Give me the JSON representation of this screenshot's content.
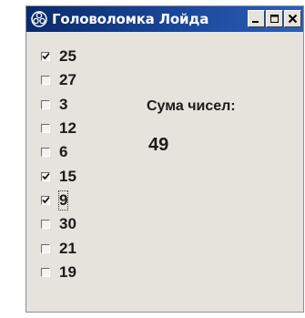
{
  "window": {
    "title": "Головоломка Лойда",
    "icon": "gear-flower-icon"
  },
  "checkboxes": [
    {
      "label": "25",
      "checked": true
    },
    {
      "label": "27",
      "checked": false
    },
    {
      "label": "3",
      "checked": false
    },
    {
      "label": "12",
      "checked": false
    },
    {
      "label": "6",
      "checked": false
    },
    {
      "label": "15",
      "checked": true
    },
    {
      "label": "9",
      "checked": true,
      "focused": true
    },
    {
      "label": "30",
      "checked": false
    },
    {
      "label": "21",
      "checked": false
    },
    {
      "label": "19",
      "checked": false
    }
  ],
  "sum": {
    "label": "Сума чисел:",
    "value": "49"
  },
  "colors": {
    "titlebar": "#1c4a9e",
    "window_bg": "#e6e3dc"
  }
}
